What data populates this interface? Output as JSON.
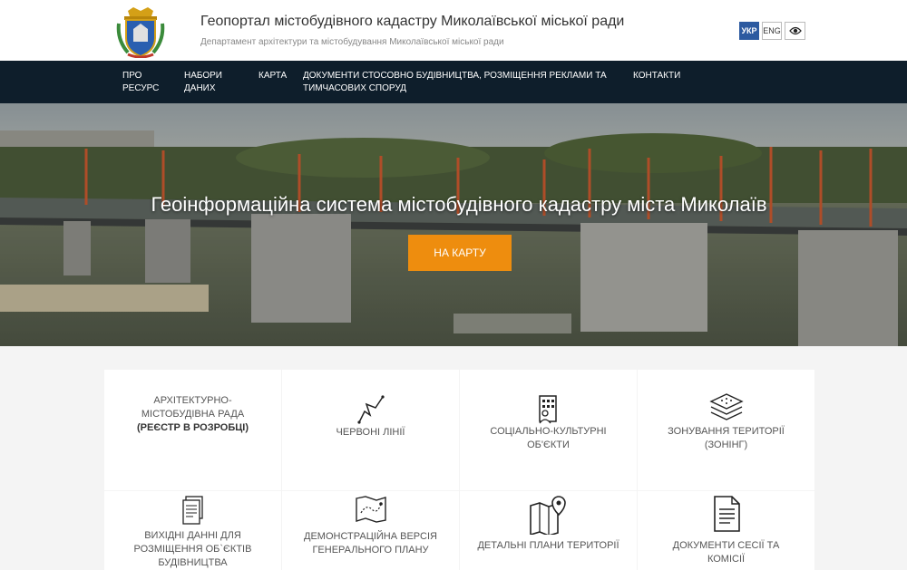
{
  "header": {
    "title": "Геопортал містобудівного кадастру Миколаївської міської ради",
    "subtitle": "Департамент архітектури та містобудування Миколаївської міської ради",
    "lang_ukr": "УКР",
    "lang_eng": "ENG",
    "colors": {
      "accent": "#2c5aa0"
    }
  },
  "nav": {
    "items": [
      {
        "label_line1": "ПРО",
        "label_line2": "РЕСУРС"
      },
      {
        "label_line1": "НАБОРИ",
        "label_line2": "ДАНИХ"
      },
      {
        "label_line1": "КАРТА",
        "label_line2": ""
      },
      {
        "label_line1": "ДОКУМЕНТИ СТОСОВНО БУДІВНИЦТВА, РОЗМІЩЕННЯ РЕКЛАМИ ТА",
        "label_line2": "ТИМЧАСОВИХ СПОРУД"
      },
      {
        "label_line1": "КОНТАКТИ",
        "label_line2": ""
      }
    ],
    "bg_color": "#0e1e2b"
  },
  "hero": {
    "title": "Геоінформаційна система містобудівного кадастру міста Миколаїв",
    "button": "НА КАРТУ",
    "button_color": "#ee8d0e"
  },
  "cards": [
    {
      "line1": "АРХІТЕКТУРНО-",
      "line2": "МІСТОБУДІВНА РАДА",
      "line3": "(РЕЄСТР В РОЗРОБЦІ)",
      "icon": "none"
    },
    {
      "line1": "ЧЕРВОНІ ЛІНІЇ",
      "line2": "",
      "icon": "zigzag-line-icon"
    },
    {
      "line1": "СОЦІАЛЬНО-КУЛЬТУРНІ",
      "line2": "ОБ'ЄКТИ",
      "icon": "building-person-icon"
    },
    {
      "line1": "ЗОНУВАННЯ ТЕРИТОРІЇ",
      "line2": "(ЗОНІНГ)",
      "icon": "layers-icon"
    },
    {
      "line1": "ВИХІДНІ ДАННІ ДЛЯ",
      "line2": "РОЗМІЩЕННЯ ОБ`ЄКТІВ",
      "line3": "БУДІВНИЦТВА",
      "icon": "documents-stack-icon"
    },
    {
      "line1": "ДЕМОНСТРАЦІЙНА ВЕРСІЯ",
      "line2": "ГЕНЕРАЛЬНОГО ПЛАНУ",
      "icon": "map-route-icon"
    },
    {
      "line1": "ДЕТАЛЬНІ ПЛАНИ ТЕРИТОРІЇ",
      "line2": "",
      "icon": "map-pin-icon"
    },
    {
      "line1": "ДОКУМЕНТИ СЕСІЇ ТА",
      "line2": "КОМІСІЇ",
      "icon": "document-icon"
    }
  ]
}
